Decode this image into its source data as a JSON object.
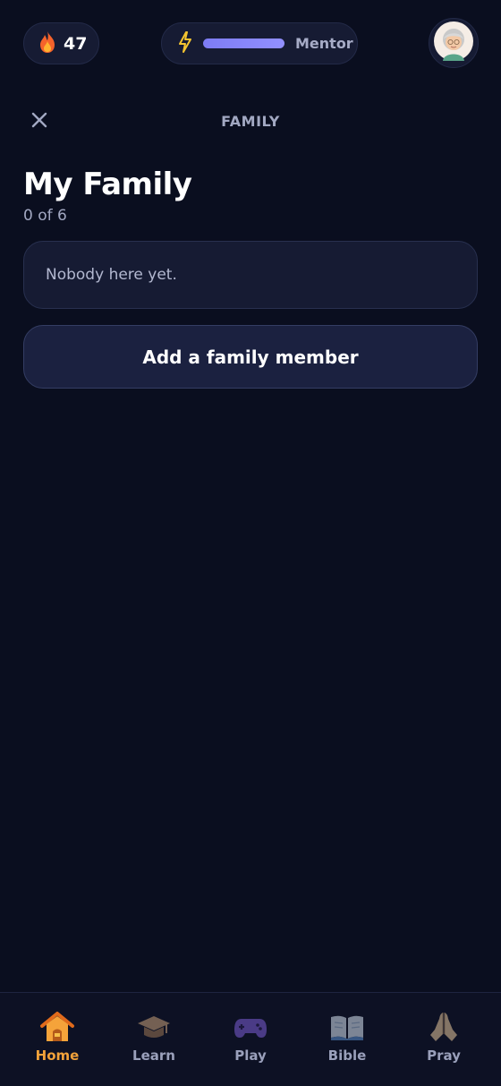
{
  "status": {
    "streak_count": "47",
    "xp_rank": "Mentor",
    "xp_progress": 1.0
  },
  "header": {
    "title": "FAMILY"
  },
  "main": {
    "heading": "My Family",
    "count": "0 of 6",
    "empty_message": "Nobody here yet.",
    "add_button": "Add a family member"
  },
  "nav": {
    "items": [
      {
        "label": "Home",
        "icon": "home-icon",
        "active": true
      },
      {
        "label": "Learn",
        "icon": "graduation-cap-icon",
        "active": false
      },
      {
        "label": "Play",
        "icon": "gamepad-icon",
        "active": false
      },
      {
        "label": "Bible",
        "icon": "open-book-icon",
        "active": false
      },
      {
        "label": "Pray",
        "icon": "praying-hands-icon",
        "active": false
      }
    ]
  },
  "colors": {
    "background": "#0a0e1f",
    "card": "#161b33",
    "accent_xp": "#8785fa",
    "active_nav": "#f2a23a"
  }
}
